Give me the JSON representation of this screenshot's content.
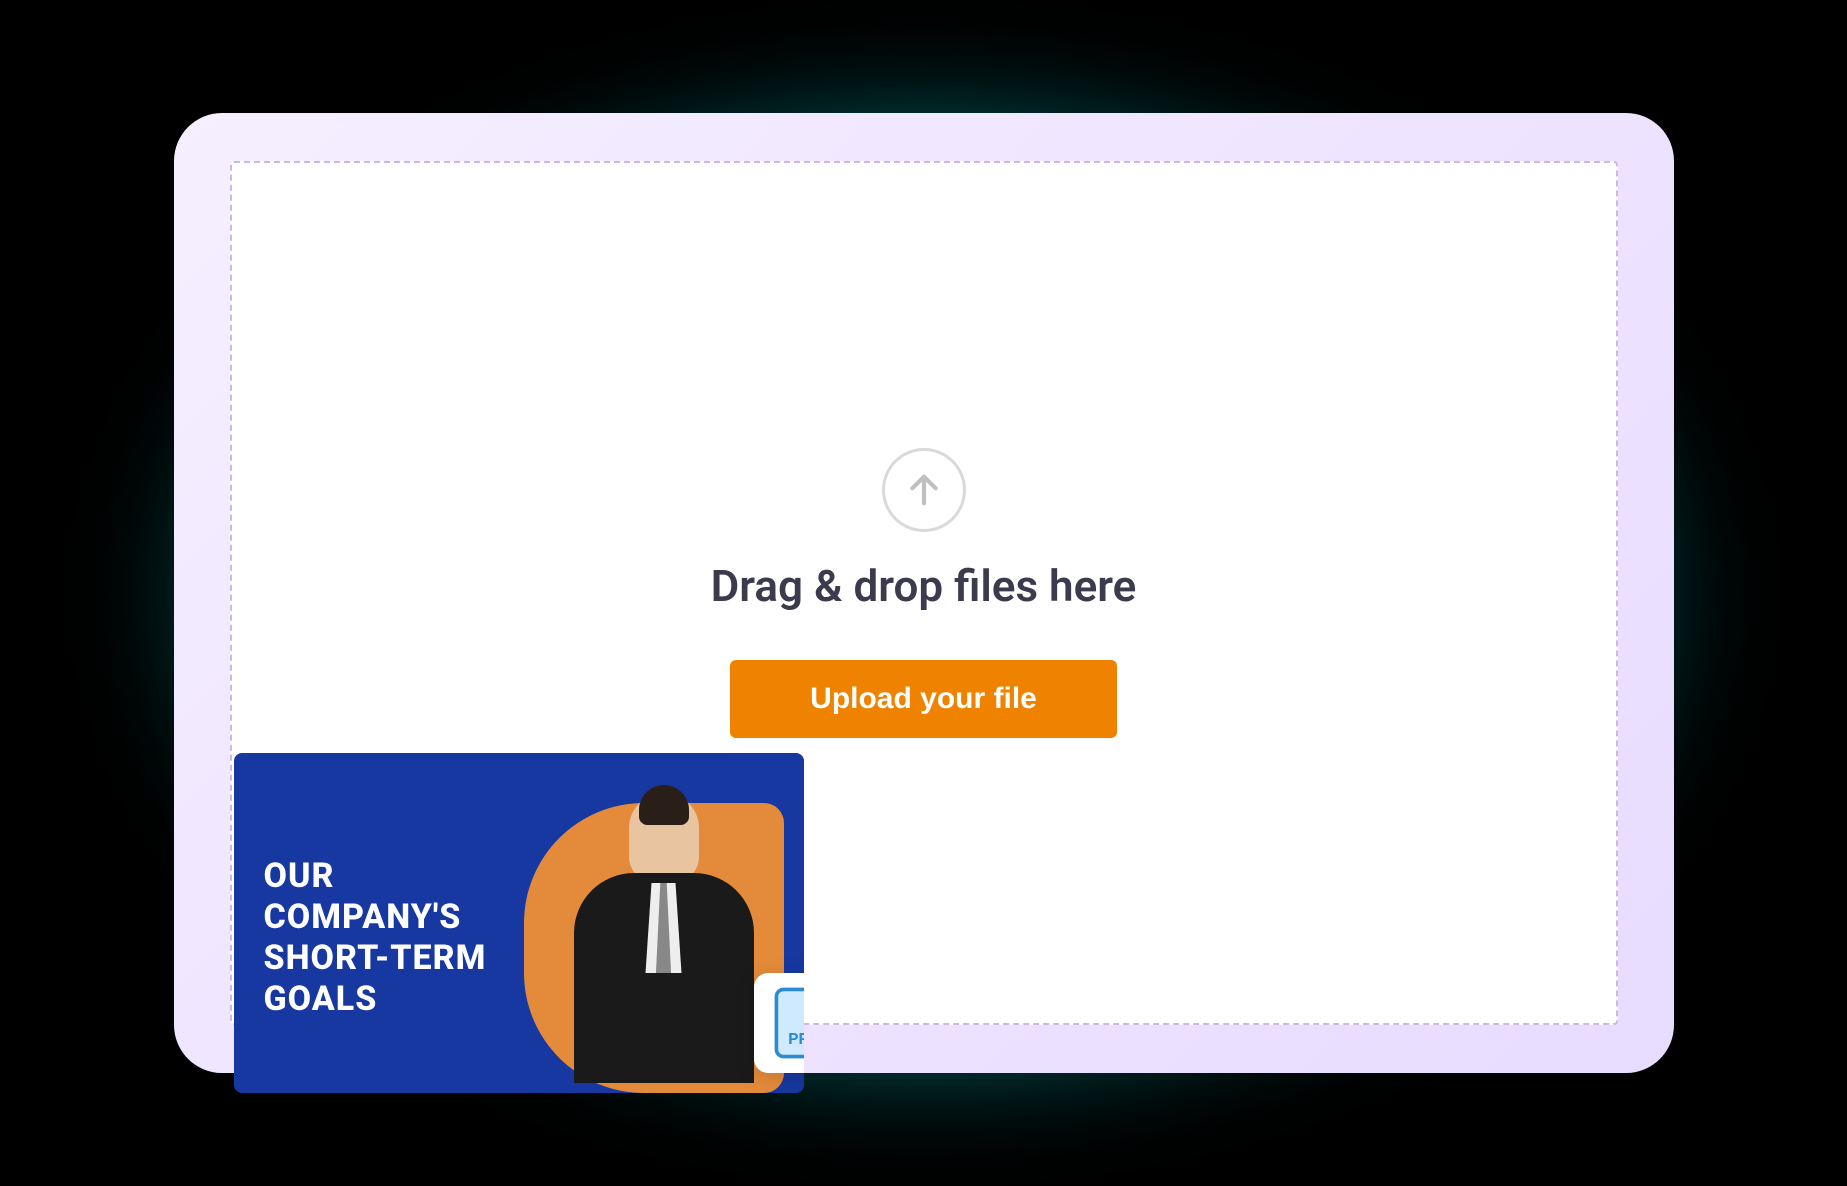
{
  "dropzone": {
    "drag_text": "Drag & drop files here",
    "upload_button": "Upload your file"
  },
  "thumbnail": {
    "title": "OUR\nCOMPANY'S\nSHORT-TERM\nGOALS",
    "file_type": "PPT"
  },
  "colors": {
    "accent_orange": "#ef8300",
    "slide_blue": "#1638a0",
    "slide_orange": "#e38b3a",
    "text_dark": "#3c3b4e"
  }
}
